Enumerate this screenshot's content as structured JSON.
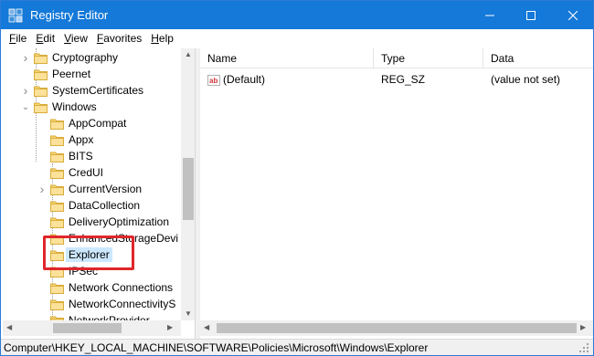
{
  "window": {
    "title": "Registry Editor",
    "accent_color": "#1479d8"
  },
  "menu": [
    {
      "underline": "F",
      "rest": "ile"
    },
    {
      "underline": "E",
      "rest": "dit"
    },
    {
      "underline": "V",
      "rest": "iew"
    },
    {
      "underline": "F",
      "rest": "avorites",
      "prefix": ""
    },
    {
      "underline": "H",
      "rest": "elp"
    }
  ],
  "tree": {
    "items": [
      {
        "label": "Cryptography",
        "expandable": true
      },
      {
        "label": "Peernet",
        "expandable": false
      },
      {
        "label": "SystemCertificates",
        "expandable": true
      },
      {
        "label": "Windows",
        "expandable": true,
        "expanded": true
      },
      {
        "label": "AppCompat",
        "expandable": false
      },
      {
        "label": "Appx",
        "expandable": false
      },
      {
        "label": "BITS",
        "expandable": false
      },
      {
        "label": "CredUI",
        "expandable": false
      },
      {
        "label": "CurrentVersion",
        "expandable": true
      },
      {
        "label": "DataCollection",
        "expandable": false
      },
      {
        "label": "DeliveryOptimization",
        "expandable": false
      },
      {
        "label": "EnhancedStorageDevi",
        "expandable": false
      },
      {
        "label": "Explorer",
        "expandable": false,
        "selected": true
      },
      {
        "label": "IPSec",
        "expandable": false
      },
      {
        "label": "Network Connections",
        "expandable": false
      },
      {
        "label": "NetworkConnectivityS",
        "expandable": false
      },
      {
        "label": "NetworkProvider",
        "expandable": false
      }
    ]
  },
  "values": {
    "columns": {
      "name": "Name",
      "type": "Type",
      "data": "Data"
    },
    "rows": [
      {
        "name": "(Default)",
        "type": "REG_SZ",
        "data": "(value not set)",
        "icon": "reg-sz-icon"
      }
    ]
  },
  "status": {
    "path": "Computer\\HKEY_LOCAL_MACHINE\\SOFTWARE\\Policies\\Microsoft\\Windows\\Explorer"
  },
  "highlight_color": "#e0262b"
}
